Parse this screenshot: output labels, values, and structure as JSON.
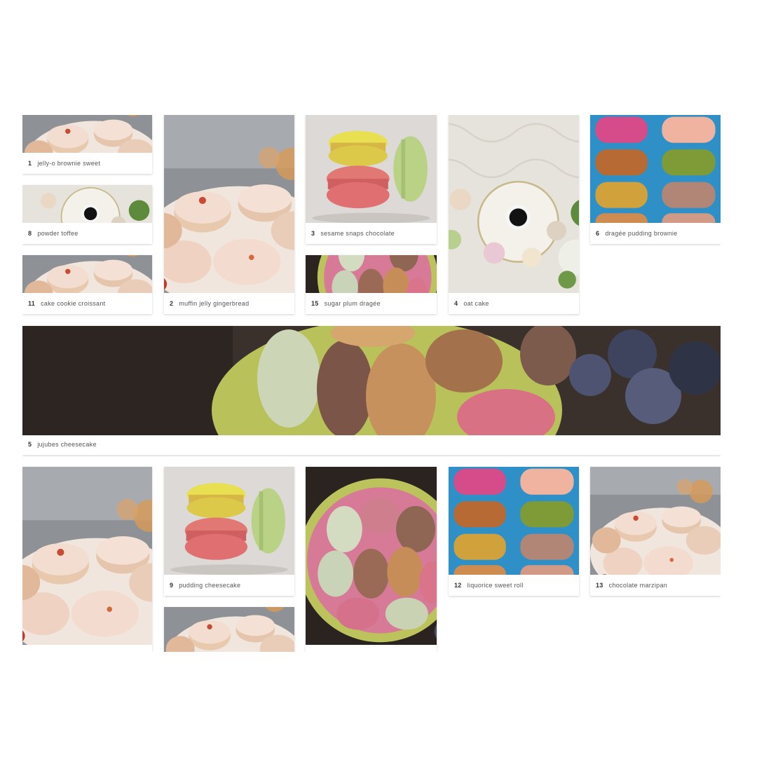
{
  "gallery": {
    "items": [
      {
        "num": "1",
        "title": "jelly-o brownie sweet",
        "image": "macaron-bowl-photo"
      },
      {
        "num": "8",
        "title": "powder toffee",
        "image": "coffee-macaron-photo"
      },
      {
        "num": "11",
        "title": "cake cookie croissant",
        "image": "macaron-bowl-photo"
      },
      {
        "num": "2",
        "title": "muffin jelly gingerbread",
        "image": "macaron-bowl-photo"
      },
      {
        "num": "3",
        "title": "sesame snaps chocolate",
        "image": "macaron-stack-photo"
      },
      {
        "num": "15",
        "title": "sugar plum dragée",
        "image": "macaron-bowl-dark-photo"
      },
      {
        "num": "4",
        "title": "oat cake",
        "image": "coffee-macaron-photo"
      },
      {
        "num": "6",
        "title": "dragée pudding brownie",
        "image": "colorful-macaron-stacks-photo"
      },
      {
        "num": "5",
        "title": "jujubes cheesecake",
        "image": "macaron-bowl-dark-photo"
      },
      {
        "num": "",
        "title": "",
        "image": "macaron-bowl-photo"
      },
      {
        "num": "9",
        "title": "pudding cheesecake",
        "image": "macaron-stack-photo"
      },
      {
        "num": "",
        "title": "",
        "image": "macaron-bowl-photo"
      },
      {
        "num": "",
        "title": "",
        "image": "macaron-bowl-dark-photo"
      },
      {
        "num": "12",
        "title": "liquorice sweet roll",
        "image": "colorful-macaron-stacks-photo"
      },
      {
        "num": "13",
        "title": "chocolate marzipan",
        "image": "macaron-bowl-photo"
      }
    ]
  }
}
